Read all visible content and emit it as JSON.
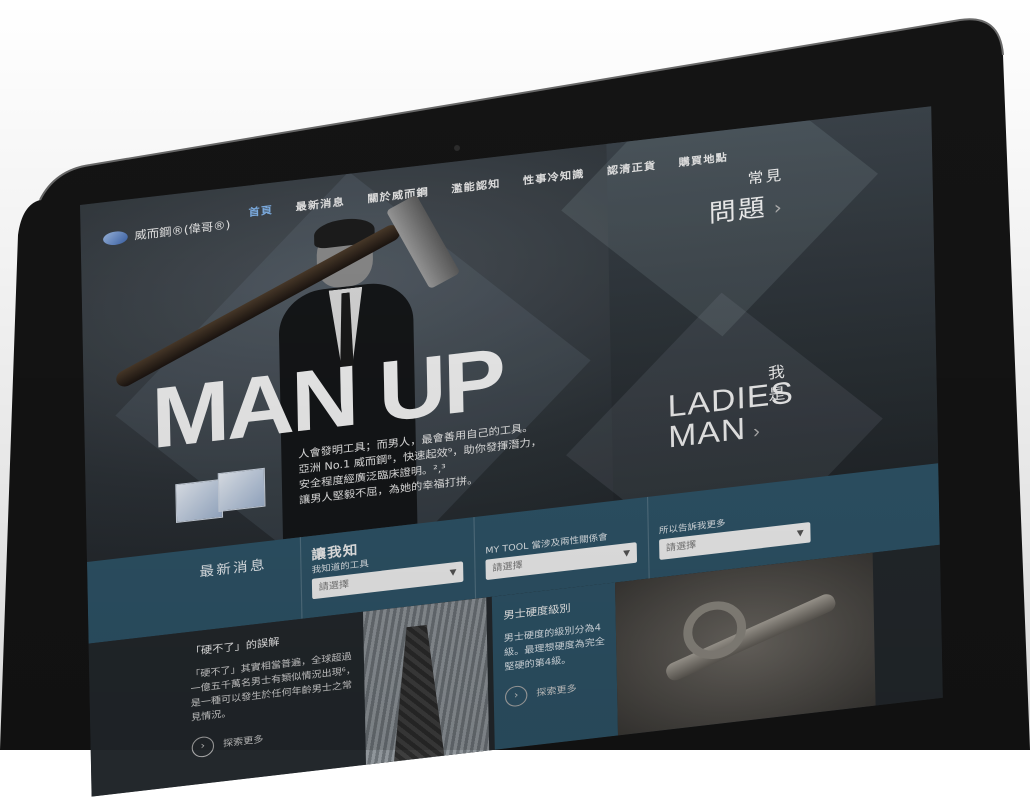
{
  "logo": {
    "text": "威而鋼®(偉哥®)"
  },
  "nav": {
    "items": [
      "首頁",
      "最新消息",
      "關於威而鋼",
      "濫能認知",
      "性事冷知識",
      "認清正貨",
      "購買地點"
    ]
  },
  "hero": {
    "headline": "MAN UP",
    "tagline": [
      "人會發明工具；而男人，最會善用自己的工具。",
      "亞洲 No.1 威而鋼⁸，快速起效⁹，助你發揮潛力，",
      "安全程度經廣泛臨床證明。²,³",
      "讓男人堅毅不屈，為她的幸福打拼。"
    ]
  },
  "faq": {
    "line1": "常見",
    "line2": "問題"
  },
  "ladies": {
    "pre": "我是",
    "line1": "LADIES",
    "line2": "MAN"
  },
  "bar": {
    "news_label": "最新消息",
    "col1": {
      "title": "讓我知",
      "subtitle": "我知道的工具",
      "select_value": "請選擇"
    },
    "col2": {
      "subtitle": "MY TOOL 當涉及兩性關係會",
      "select_value": "請選擇"
    },
    "col3": {
      "subtitle": "所以告訴我更多",
      "select_value": "請選擇"
    }
  },
  "cards": {
    "card1": {
      "title": "「硬不了」的誤解",
      "body": "「硬不了」其實相當普遍，全球超過一億五千萬名男士有類似情況出現⁶，是一種可以發生於任何年齡男士之常見情況。",
      "more": "探索更多"
    },
    "card2": {
      "title": "男士硬度級別",
      "body": "男士硬度的級別分為4級。最理想硬度為完全堅硬的第4級。",
      "more": "探索更多"
    }
  },
  "colors": {
    "accent_nav": "#7fb0e6",
    "bar": "#2e5468"
  }
}
